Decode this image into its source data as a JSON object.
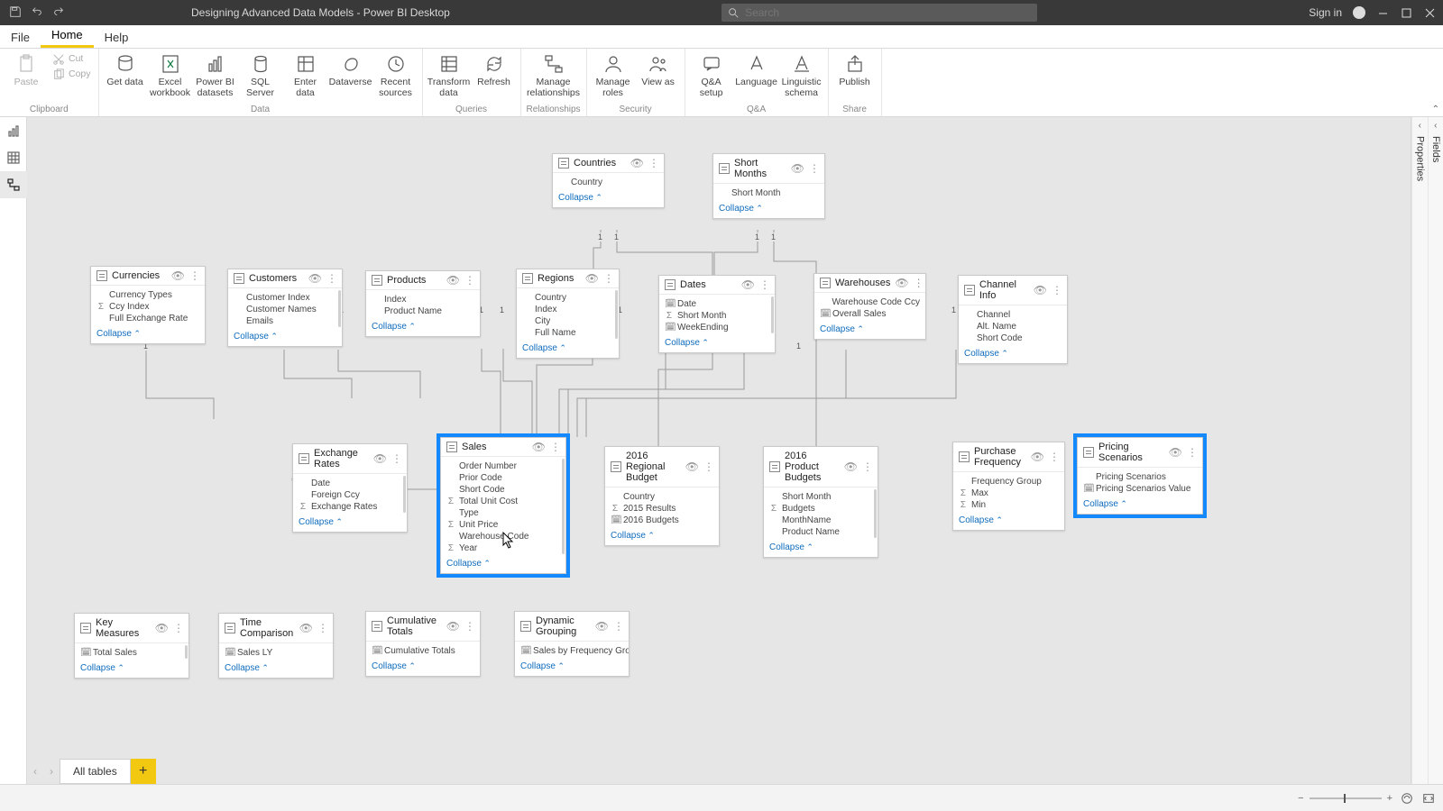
{
  "titlebar": {
    "title": "Designing Advanced Data Models - Power BI Desktop",
    "search_placeholder": "Search",
    "signin": "Sign in"
  },
  "menu": {
    "file": "File",
    "home": "Home",
    "help": "Help"
  },
  "ribbon": {
    "clipboard": {
      "label": "Clipboard",
      "paste": "Paste",
      "cut": "Cut",
      "copy": "Copy"
    },
    "data": {
      "label": "Data",
      "get": "Get data",
      "excel": "Excel workbook",
      "pbids": "Power BI datasets",
      "sql": "SQL Server",
      "enter": "Enter data",
      "dataverse": "Dataverse",
      "recent": "Recent sources"
    },
    "queries": {
      "label": "Queries",
      "transform": "Transform data",
      "refresh": "Refresh"
    },
    "relationships": {
      "label": "Relationships",
      "manage": "Manage relationships"
    },
    "security": {
      "label": "Security",
      "roles": "Manage roles",
      "viewas": "View as"
    },
    "qa": {
      "label": "Q&A",
      "setup": "Q&A setup",
      "lang": "Language",
      "ling": "Linguistic schema"
    },
    "share": {
      "label": "Share",
      "publish": "Publish"
    }
  },
  "panes": {
    "properties": "Properties",
    "fields": "Fields"
  },
  "bottom_tab": "All tables",
  "collapse_label": "Collapse",
  "tables": {
    "countries": {
      "name": "Countries",
      "fields": [
        [
          "",
          "Country"
        ]
      ]
    },
    "shortmonths": {
      "name": "Short Months",
      "fields": [
        [
          "",
          "Short Month"
        ]
      ]
    },
    "currencies": {
      "name": "Currencies",
      "fields": [
        [
          "",
          "Currency Types"
        ],
        [
          "Σ",
          "Ccy Index"
        ],
        [
          "",
          "Full Exchange Rate"
        ]
      ]
    },
    "customers": {
      "name": "Customers",
      "fields": [
        [
          "",
          "Customer Index"
        ],
        [
          "",
          "Customer Names"
        ],
        [
          "",
          "Emails"
        ]
      ]
    },
    "products": {
      "name": "Products",
      "fields": [
        [
          "",
          "Index"
        ],
        [
          "",
          "Product Name"
        ]
      ]
    },
    "regions": {
      "name": "Regions",
      "fields": [
        [
          "",
          "Country"
        ],
        [
          "",
          "Index"
        ],
        [
          "",
          "City"
        ],
        [
          "",
          "Full Name"
        ]
      ]
    },
    "dates": {
      "name": "Dates",
      "fields": [
        [
          "🗓",
          "Date"
        ],
        [
          "Σ",
          "Short Month"
        ],
        [
          "🗓",
          "WeekEnding"
        ]
      ]
    },
    "warehouses": {
      "name": "Warehouses",
      "fields": [
        [
          "",
          "Warehouse Code Ccy"
        ],
        [
          "🗓",
          "Overall Sales"
        ]
      ]
    },
    "channelinfo": {
      "name": "Channel Info",
      "fields": [
        [
          "",
          "Channel"
        ],
        [
          "",
          "Alt. Name"
        ],
        [
          "",
          "Short Code"
        ]
      ]
    },
    "exchangerates": {
      "name": "Exchange Rates",
      "fields": [
        [
          "",
          "Date"
        ],
        [
          "",
          "Foreign Ccy"
        ],
        [
          "Σ",
          "Exchange Rates"
        ]
      ]
    },
    "sales": {
      "name": "Sales",
      "fields": [
        [
          "",
          "Order Number"
        ],
        [
          "",
          "Prior Code"
        ],
        [
          "",
          "Short Code"
        ],
        [
          "Σ",
          "Total Unit Cost"
        ],
        [
          "",
          "Type"
        ],
        [
          "Σ",
          "Unit Price"
        ],
        [
          "",
          "Warehouse Code"
        ],
        [
          "Σ",
          "Year"
        ]
      ]
    },
    "regbudget": {
      "name": "2016 Regional Budget",
      "fields": [
        [
          "",
          "Country"
        ],
        [
          "Σ",
          "2015 Results"
        ],
        [
          "🗓",
          "2016 Budgets"
        ]
      ]
    },
    "prodbudget": {
      "name": "2016 Product Budgets",
      "fields": [
        [
          "",
          "Short Month"
        ],
        [
          "Σ",
          "Budgets"
        ],
        [
          "",
          "MonthName"
        ],
        [
          "",
          "Product Name"
        ]
      ]
    },
    "purchasefreq": {
      "name": "Purchase Frequency",
      "fields": [
        [
          "",
          "Frequency Group"
        ],
        [
          "Σ",
          "Max"
        ],
        [
          "Σ",
          "Min"
        ]
      ]
    },
    "pricing": {
      "name": "Pricing Scenarios",
      "fields": [
        [
          "",
          "Pricing Scenarios"
        ],
        [
          "🗓",
          "Pricing Scenarios Value"
        ]
      ]
    },
    "keymeasures": {
      "name": "Key Measures",
      "fields": [
        [
          "🗓",
          "Total Sales"
        ]
      ]
    },
    "timecomp": {
      "name": "Time Comparison",
      "fields": [
        [
          "🗓",
          "Sales LY"
        ]
      ]
    },
    "cumtotals": {
      "name": "Cumulative Totals",
      "fields": [
        [
          "🗓",
          "Cumulative Totals"
        ]
      ]
    },
    "dyngroup": {
      "name": "Dynamic Grouping",
      "fields": [
        [
          "🗓",
          "Sales by Frequency Group"
        ]
      ]
    }
  }
}
